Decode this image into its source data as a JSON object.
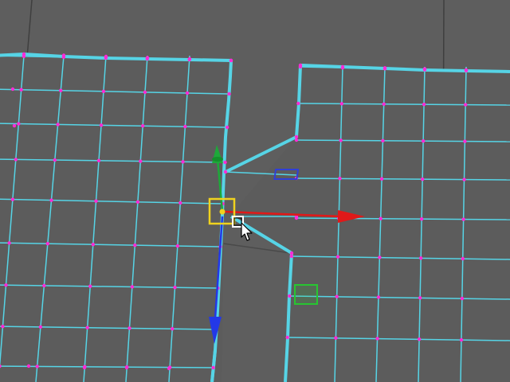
{
  "viewport": {
    "name": "3d-modeling-viewport",
    "background": "#5e5e5e",
    "mesh_edge_color": "#56d4e6",
    "vertex_color": "#ff2bd6",
    "selected_edge_color": "#56d4e6"
  },
  "gizmo": {
    "type": "move-manipulator",
    "x_axis_color": "#e01919",
    "y_axis_color": "#1ea83a",
    "z_axis_color": "#2338e8",
    "center_handle_color": "#f0d21e"
  },
  "plane_handles": {
    "xy_color": "#2f3fd8",
    "yz_color": "#27c631"
  },
  "cursor": {
    "icon": "move-cursor-icon"
  }
}
